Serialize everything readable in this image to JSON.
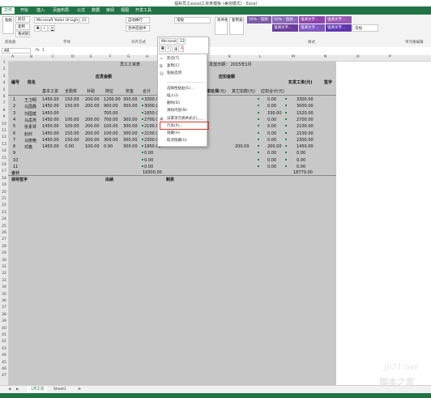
{
  "window": {
    "title": "福和员工excel工资表模板 (兼容模式) - Excel"
  },
  "ribbon_tabs": [
    "文件",
    "开始",
    "插入",
    "页面布局",
    "公式",
    "数据",
    "审阅",
    "视图",
    "开发工具"
  ],
  "ribbon": {
    "font_name": "Microsoft YaHei UI Ligh",
    "font_size": "12",
    "number_format": "常规",
    "groups": {
      "clipboard": "剪贴板",
      "font": "字体",
      "alignment": "对齐方式",
      "styles": "样式",
      "editing": "单元格编辑"
    },
    "buttons": {
      "paste": "粘贴",
      "cut": "剪切",
      "copy": "复制",
      "format_painter": "格式刷",
      "wrap": "自动换行",
      "merge": "合并后居中",
      "cond_format": "条件格式",
      "table_format": "套用表格格式"
    },
    "style_cells": [
      {
        "label": "50% - 强调...",
        "color": "#7b5aa6"
      },
      {
        "label": "50% - 强调...",
        "color": "#8b67b8"
      },
      {
        "label": "强调文字...",
        "color": "#8e44ad"
      },
      {
        "label": "强调文字...",
        "color": "#9b59b6"
      },
      {
        "label": "强调文字...",
        "color": "#6a3d9a"
      },
      {
        "label": "强调文字...",
        "color": "#7e57c2"
      },
      {
        "label": "强调文字...",
        "color": "#5e35b1"
      },
      {
        "label": "常规",
        "color": "#ffffff"
      }
    ]
  },
  "formula_bar": {
    "name_box": "A6",
    "value": "1"
  },
  "columns": [
    "A",
    "B",
    "C",
    "D",
    "E",
    "F",
    "G",
    "H",
    "I",
    "J",
    "K",
    "L",
    "M",
    "N",
    "O",
    "P"
  ],
  "rows": [
    "1",
    "2",
    "3",
    "4",
    "5",
    "6",
    "7",
    "8",
    "9",
    "10",
    "11",
    "12",
    "13",
    "14",
    "15",
    "16",
    "17",
    "18",
    "19",
    "20",
    "21",
    "22",
    "23",
    "24",
    "25",
    "26",
    "27",
    "28",
    "29",
    "30",
    "31",
    "32",
    "33",
    "34",
    "35",
    "36",
    "37",
    "38",
    "39",
    "40",
    "41",
    "42",
    "43",
    "44",
    "45",
    "46",
    "47"
  ],
  "sheet": {
    "title_left": "员工工资表",
    "title_date": "发放日期： 2015年1月",
    "header_no": "编号",
    "header_name": "姓名",
    "header_payable": "应发金额",
    "header_deduct": "应扣金额",
    "header_net": "实发工资(元)",
    "header_sign": "签字",
    "sub_headers": [
      "基本工资",
      "全勤奖",
      "补助",
      "岗位",
      "奖金",
      "合计"
    ],
    "sub_deduct": [
      "应扣社保(元)",
      "其它扣款(元)",
      "应扣合计(元)"
    ],
    "employees": [
      {
        "no": "1",
        "name": "王卫明",
        "base": "1450.00",
        "attend": "150.00",
        "sub": "200.00",
        "post": "1200.00",
        "bonus": "300.00",
        "total": "3300.00",
        "deduct": "0.00",
        "net": "3300.00"
      },
      {
        "no": "2",
        "name": "马国鑫",
        "base": "1450.00",
        "attend": "150.00",
        "sub": "200.00",
        "post": "900.00",
        "bonus": "300.00",
        "total": "3000.00",
        "deduct": "0.00",
        "net": "3000.00"
      },
      {
        "no": "3",
        "name": "刘国斌",
        "base": "1450.00",
        "attend": "",
        "sub": "",
        "post": "700.00",
        "bonus": "",
        "total": "1850.00",
        "deduct": "330.00",
        "net": "1520.00"
      },
      {
        "no": "4",
        "name": "马岳男",
        "base": "1450.00",
        "attend": "100.00",
        "sub": "200.00",
        "post": "700.00",
        "bonus": "300.00",
        "total": "2700.00",
        "deduct": "0.00",
        "net": "2700.00"
      },
      {
        "no": "5",
        "name": "张素琴",
        "base": "1450.00",
        "attend": "100.00",
        "sub": "200.00",
        "post": "100.00",
        "bonus": "300.00",
        "total": "2100.00",
        "deduct": "0.00",
        "net": "2100.00"
      },
      {
        "no": "6",
        "name": "赵欣",
        "base": "1450.00",
        "attend": "150.00",
        "sub": "200.00",
        "post": "100.00",
        "bonus": "300.00",
        "total": "2100.00",
        "deduct": "0.00",
        "net": "2100.00"
      },
      {
        "no": "7",
        "name": "马丽艳",
        "base": "1450.00",
        "attend": "150.00",
        "sub": "200.00",
        "post": "300.00",
        "bonus": "300.00",
        "total": "2300.00",
        "deduct": "0.00",
        "net": "2300.00"
      },
      {
        "no": "8",
        "name": "邓鑫",
        "base": "1450.00",
        "attend": "0.00",
        "sub": "100.00",
        "post": "0.00",
        "bonus": "300.00",
        "total": "1850.00",
        "other": "200.00",
        "deduct": "200.00",
        "net": "1450.00"
      },
      {
        "no": "9",
        "name": "",
        "total": "0.00",
        "deduct": "0.00",
        "net": "0.00"
      },
      {
        "no": "10",
        "name": "",
        "total": "0.00",
        "deduct": "0.00",
        "net": "0.00"
      },
      {
        "no": "11",
        "name": "",
        "total": "0.00",
        "deduct": "0.00",
        "net": "0.00"
      }
    ],
    "subtotal_label": "合计",
    "subtotal_total": "19300.00",
    "subtotal_net": "18770.00",
    "footer_leader": "领导签字",
    "footer_cashier": "出纳",
    "footer_maker": "制表"
  },
  "mini_toolbar": {
    "font": "Microsof",
    "size": "12"
  },
  "context_menu": [
    {
      "label": "剪切(T)",
      "icon": "scissors-icon",
      "glyph": "✂"
    },
    {
      "label": "复制(C)",
      "icon": "copy-icon",
      "glyph": "⧉"
    },
    {
      "label": "粘贴选项:",
      "icon": "paste-icon",
      "glyph": "▤"
    },
    {
      "label": "",
      "icon": "",
      "glyph": ""
    },
    {
      "label": "选择性粘贴(S)...",
      "icon": "",
      "glyph": ""
    },
    {
      "label": "插入(I)",
      "icon": "",
      "glyph": ""
    },
    {
      "label": "删除(D)",
      "icon": "",
      "glyph": ""
    },
    {
      "label": "清除内容(N)",
      "icon": "",
      "glyph": ""
    },
    {
      "label": "设置单元格格式(F)...",
      "icon": "format-cells-icon",
      "glyph": "▦"
    },
    {
      "label": "行高(R)...",
      "icon": "",
      "glyph": ""
    },
    {
      "label": "隐藏(H)",
      "icon": "",
      "glyph": ""
    },
    {
      "label": "取消隐藏(U)",
      "icon": "",
      "glyph": ""
    }
  ],
  "sheets": [
    "1月工资",
    "Sheet1"
  ],
  "watermark": {
    "site": "jb51.net",
    "brand": "脚本之家"
  }
}
